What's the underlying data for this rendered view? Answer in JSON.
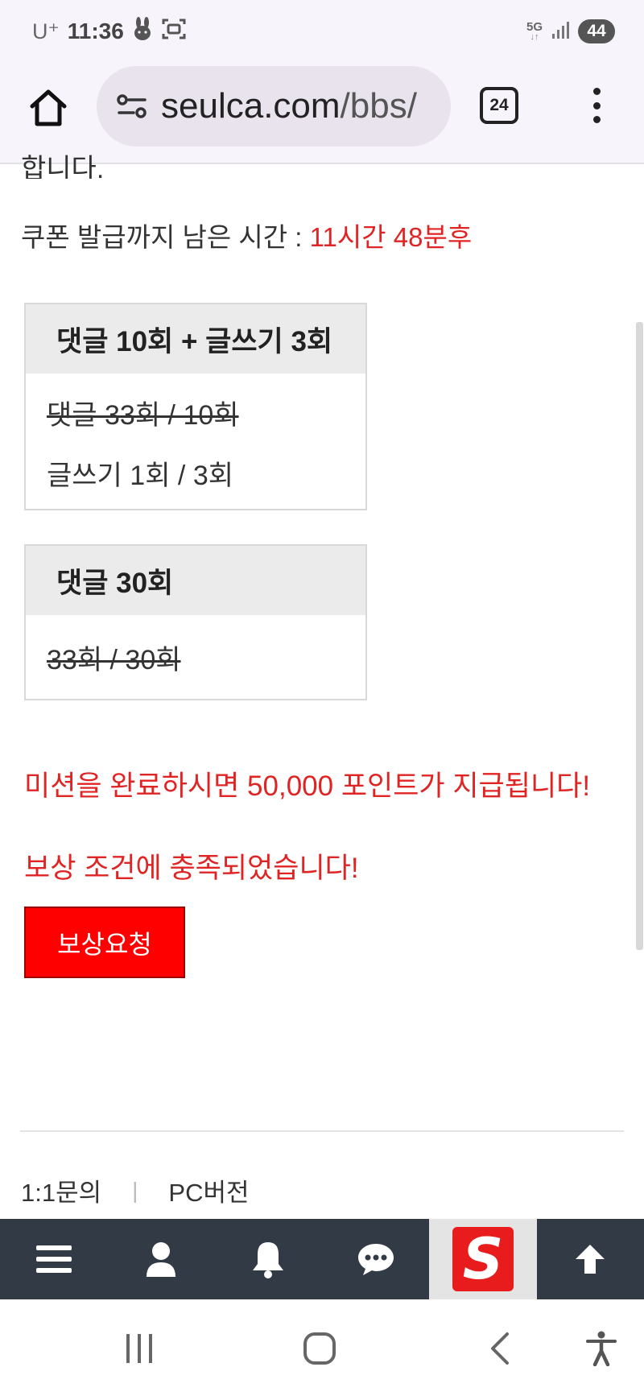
{
  "status_bar": {
    "carrier": "U⁺",
    "time": "11:36",
    "network": "5G",
    "battery": "44"
  },
  "browser": {
    "url_host": "seulca.com",
    "url_path": "/bbs/",
    "tab_count": "24"
  },
  "content": {
    "cut_text": "합니다.",
    "coupon_label": "쿠폰 발급까지 남은 시간 : ",
    "coupon_time": "11시간 48분후",
    "missions": [
      {
        "title": "댓글 10회 + 글쓰기 3회",
        "rows": [
          {
            "text": "댓글 33회 / 10회",
            "done": true
          },
          {
            "text": "글쓰기 1회 / 3회",
            "done": false
          }
        ]
      },
      {
        "title": "댓글 30회",
        "rows": [
          {
            "text": "33회 / 30회",
            "done": true
          }
        ]
      }
    ],
    "reward_notice": "미션을 완료하시면 50,000 포인트가 지급됩니다!",
    "condition_notice": "보상 조건에 충족되었습니다!",
    "reward_button": "보상요청"
  },
  "footer": {
    "links": [
      "1:1문의",
      "PC버전"
    ],
    "separator": "|"
  },
  "bottom_nav": {
    "logo_letter": "S",
    "icons": [
      "hamburger-menu-icon",
      "user-icon",
      "bell-icon",
      "chat-icon",
      "site-logo",
      "arrow-up-icon"
    ]
  },
  "colors": {
    "accent_red": "#e02424",
    "button_red": "#ff0000",
    "nav_bg": "#323a45"
  }
}
